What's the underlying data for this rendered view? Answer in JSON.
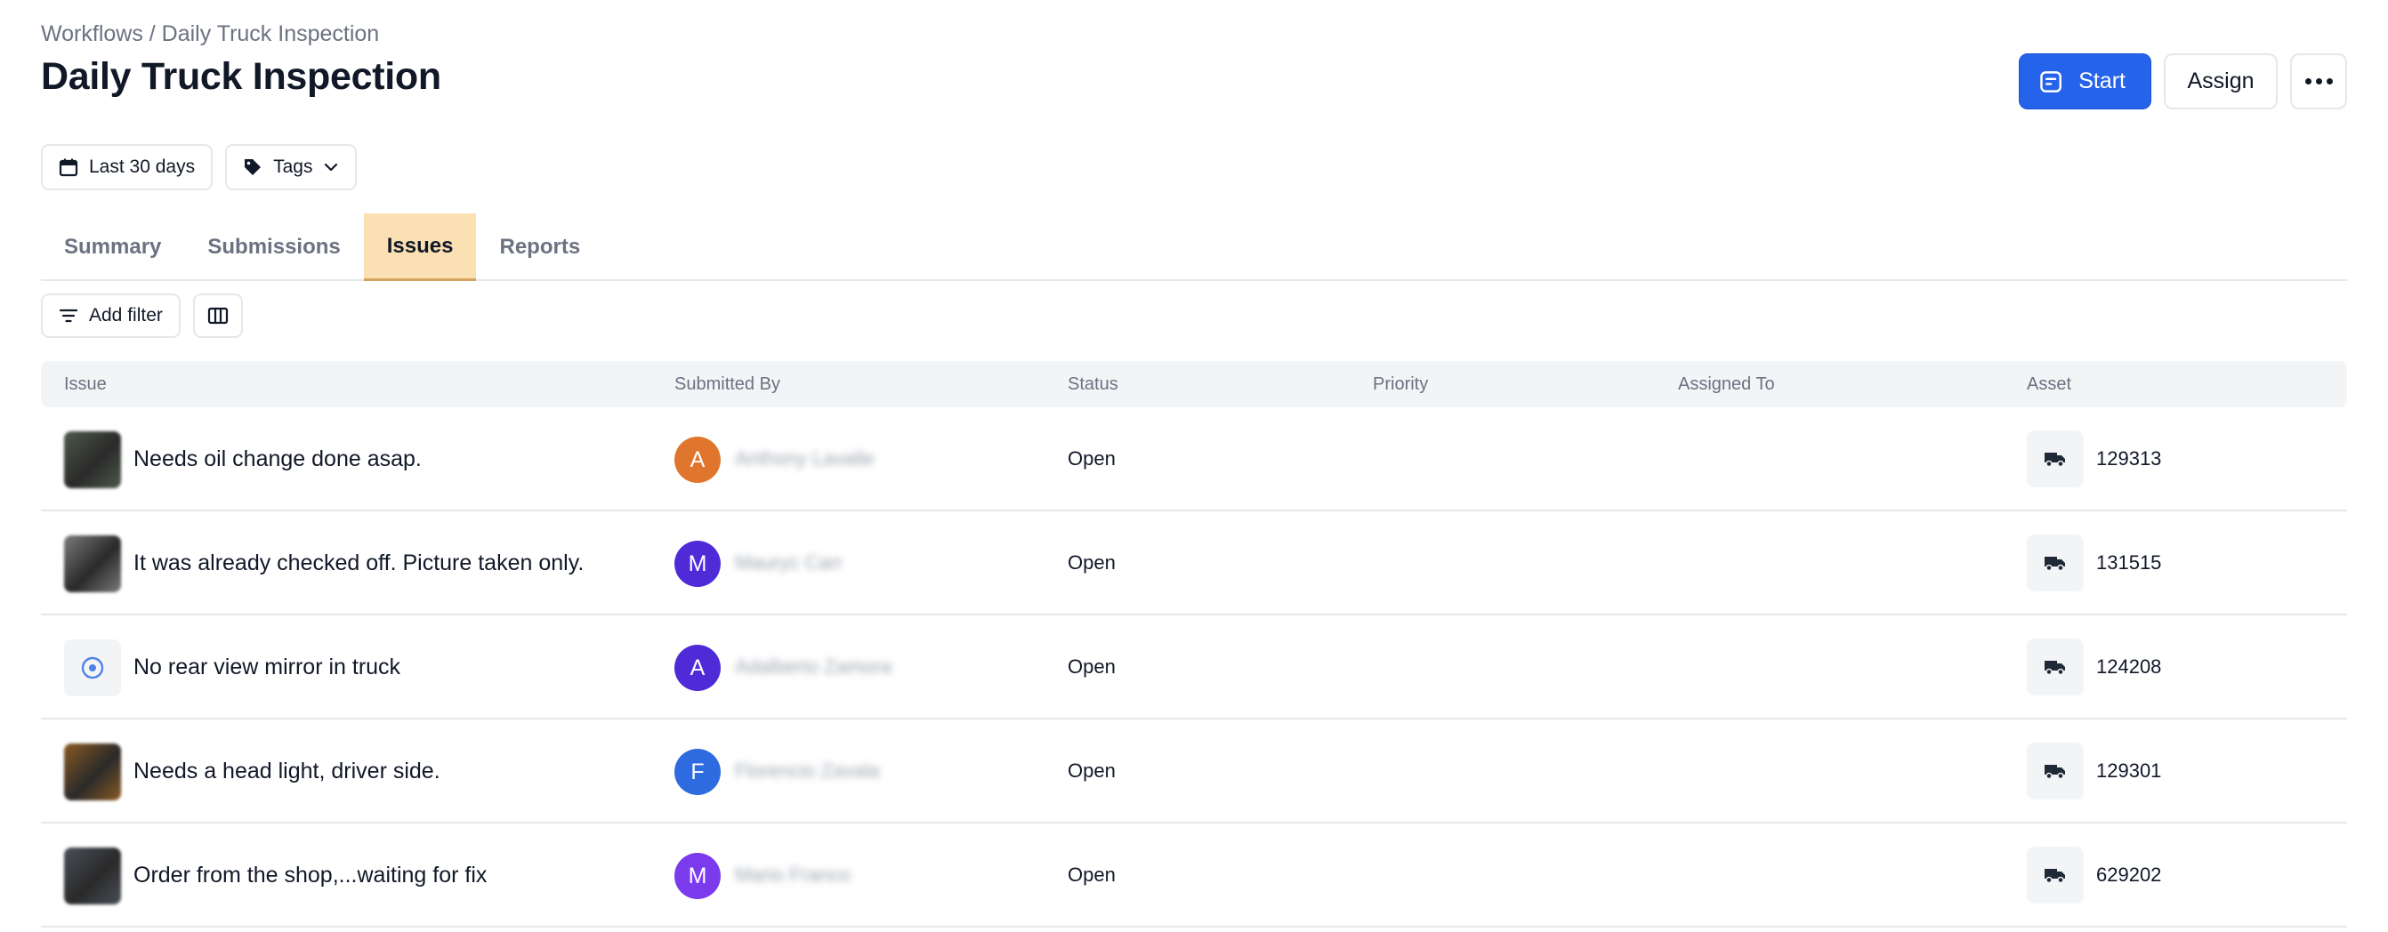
{
  "breadcrumb": "Workflows / Daily Truck Inspection",
  "title": "Daily Truck Inspection",
  "actions": {
    "start_label": "Start",
    "assign_label": "Assign"
  },
  "filters": {
    "date_range": "Last 30 days",
    "tags": "Tags"
  },
  "tabs": [
    {
      "label": "Summary",
      "active": false
    },
    {
      "label": "Submissions",
      "active": false
    },
    {
      "label": "Issues",
      "active": true
    },
    {
      "label": "Reports",
      "active": false
    }
  ],
  "toolbar": {
    "add_filter_label": "Add filter"
  },
  "table": {
    "columns": [
      "Issue",
      "Submitted By",
      "Status",
      "Priority",
      "Assigned To",
      "Asset"
    ],
    "rows": [
      {
        "issue": "Needs oil change done asap.",
        "initial": "A",
        "avatar_color": "#e0752d",
        "submitted_by": "Anthony Lavalle",
        "status": "Open",
        "priority": "",
        "assigned_to": "",
        "asset": "129313",
        "thumb": "photo",
        "thumb_color": "#4d5a4a"
      },
      {
        "issue": "It was already checked off. Picture taken only.",
        "initial": "M",
        "avatar_color": "#4f2bd8",
        "submitted_by": "Mauryc Carr",
        "status": "Open",
        "priority": "",
        "assigned_to": "",
        "asset": "131515",
        "thumb": "photo",
        "thumb_color": "#7b7b7e"
      },
      {
        "issue": "No rear view mirror in truck",
        "initial": "A",
        "avatar_color": "#4f2bd8",
        "submitted_by": "Adalberto Zamora",
        "status": "Open",
        "priority": "",
        "assigned_to": "",
        "asset": "124208",
        "thumb": "icon",
        "thumb_color": "#f3f4f6"
      },
      {
        "issue": "Needs a head light, driver side.",
        "initial": "F",
        "avatar_color": "#2f6be0",
        "submitted_by": "Florencio Zavala",
        "status": "Open",
        "priority": "",
        "assigned_to": "",
        "asset": "129301",
        "thumb": "photo",
        "thumb_color": "#8a5a22"
      },
      {
        "issue": "Order from the shop,...waiting for fix",
        "initial": "M",
        "avatar_color": "#7c3aed",
        "submitted_by": "Mario Franco",
        "status": "Open",
        "priority": "",
        "assigned_to": "",
        "asset": "629202",
        "thumb": "photo",
        "thumb_color": "#4a4e58"
      }
    ]
  }
}
